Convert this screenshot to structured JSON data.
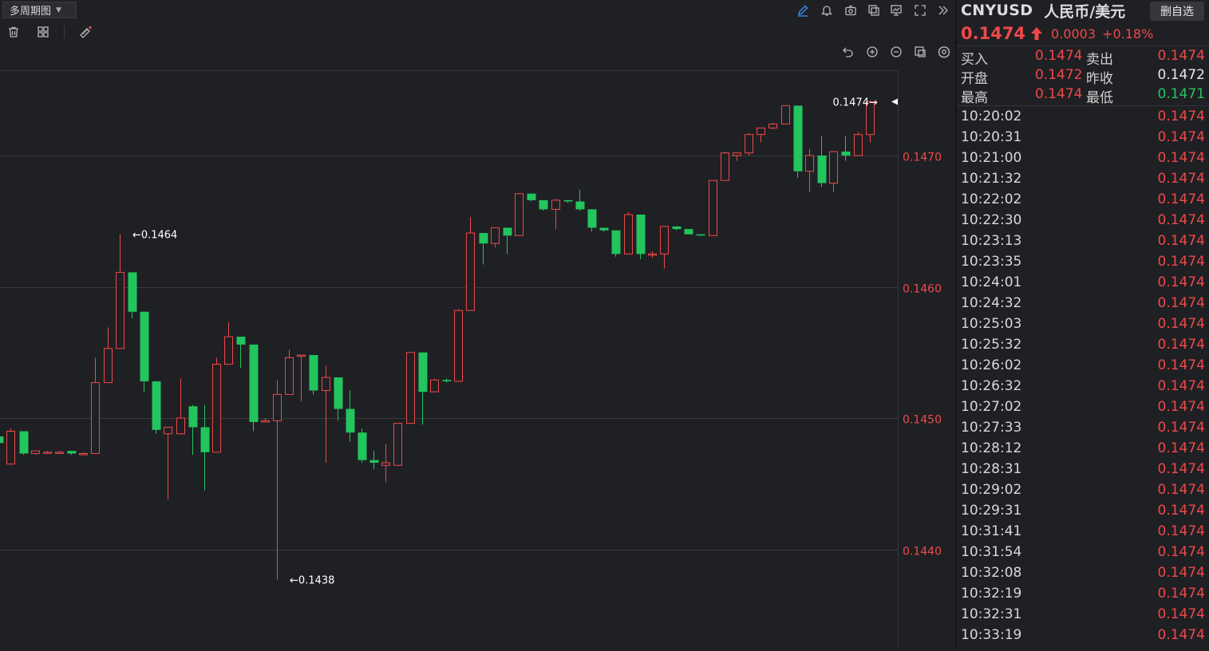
{
  "toolbar": {
    "period_label": "多周期图",
    "left_icons": [
      "trash-icon",
      "layout-icon",
      "ruler-icon"
    ],
    "right_icons": [
      "pencil-icon",
      "bell-icon",
      "camera-icon",
      "copy-icon",
      "indicator-icon",
      "fullscreen-icon",
      "collapse-icon"
    ],
    "chart_icons": [
      "undo-icon",
      "zoom-in-icon",
      "zoom-out-icon",
      "chart-style-icon",
      "settings-icon"
    ]
  },
  "colors": {
    "up": "#f04848",
    "down": "#22c55e",
    "background": "#1f2024"
  },
  "chart_data": {
    "type": "candlestick",
    "y_ticks": [
      "0.1470",
      "0.1460",
      "0.1450",
      "0.1440"
    ],
    "y_tick_values": [
      0.147,
      0.146,
      0.145,
      0.144
    ],
    "ylim": [
      0.14325,
      0.14765
    ],
    "annotations": [
      {
        "label": "←0.1464",
        "index": 11,
        "value": 0.1464,
        "side": "right"
      },
      {
        "label": "←0.1438",
        "index": 24,
        "value": 0.14377,
        "side": "right"
      },
      {
        "label": "0.1474→",
        "index": 73,
        "value": 0.14741,
        "side": "left"
      }
    ],
    "last_price_marker": 0.14741,
    "candles": [
      {
        "o": 0.14486,
        "h": 0.14492,
        "l": 0.14481,
        "c": 0.14481
      },
      {
        "o": 0.14465,
        "h": 0.14492,
        "l": 0.14465,
        "c": 0.1449
      },
      {
        "o": 0.1449,
        "h": 0.1449,
        "l": 0.14472,
        "c": 0.14473
      },
      {
        "o": 0.14473,
        "h": 0.14475,
        "l": 0.14472,
        "c": 0.14475
      },
      {
        "o": 0.14474,
        "h": 0.14475,
        "l": 0.14473,
        "c": 0.14474
      },
      {
        "o": 0.14474,
        "h": 0.14475,
        "l": 0.14473,
        "c": 0.14474
      },
      {
        "o": 0.14475,
        "h": 0.14475,
        "l": 0.14472,
        "c": 0.14473
      },
      {
        "o": 0.14473,
        "h": 0.14474,
        "l": 0.14473,
        "c": 0.14473
      },
      {
        "o": 0.14473,
        "h": 0.14546,
        "l": 0.14473,
        "c": 0.14527
      },
      {
        "o": 0.14527,
        "h": 0.14569,
        "l": 0.14527,
        "c": 0.14553
      },
      {
        "o": 0.14553,
        "h": 0.1464,
        "l": 0.14553,
        "c": 0.14611
      },
      {
        "o": 0.14611,
        "h": 0.14611,
        "l": 0.14576,
        "c": 0.14581
      },
      {
        "o": 0.14581,
        "h": 0.14581,
        "l": 0.1452,
        "c": 0.14528
      },
      {
        "o": 0.14528,
        "h": 0.14528,
        "l": 0.14488,
        "c": 0.14491
      },
      {
        "o": 0.14488,
        "h": 0.14493,
        "l": 0.14438,
        "c": 0.14493
      },
      {
        "o": 0.14488,
        "h": 0.1453,
        "l": 0.14488,
        "c": 0.145
      },
      {
        "o": 0.14509,
        "h": 0.1451,
        "l": 0.14472,
        "c": 0.14493
      },
      {
        "o": 0.14493,
        "h": 0.1451,
        "l": 0.14445,
        "c": 0.14474
      },
      {
        "o": 0.14474,
        "h": 0.14546,
        "l": 0.14474,
        "c": 0.14541
      },
      {
        "o": 0.14541,
        "h": 0.14573,
        "l": 0.14541,
        "c": 0.14562
      },
      {
        "o": 0.14562,
        "h": 0.14562,
        "l": 0.14538,
        "c": 0.14556
      },
      {
        "o": 0.14556,
        "h": 0.14556,
        "l": 0.1449,
        "c": 0.14497
      },
      {
        "o": 0.14497,
        "h": 0.145,
        "l": 0.14497,
        "c": 0.14498
      },
      {
        "o": 0.14498,
        "h": 0.14529,
        "l": 0.14377,
        "c": 0.14518
      },
      {
        "o": 0.14518,
        "h": 0.14552,
        "l": 0.14518,
        "c": 0.14546
      },
      {
        "o": 0.14548,
        "h": 0.14548,
        "l": 0.14513,
        "c": 0.14548
      },
      {
        "o": 0.14548,
        "h": 0.14548,
        "l": 0.14518,
        "c": 0.14521
      },
      {
        "o": 0.14521,
        "h": 0.1454,
        "l": 0.14466,
        "c": 0.14531
      },
      {
        "o": 0.14531,
        "h": 0.14531,
        "l": 0.14498,
        "c": 0.14507
      },
      {
        "o": 0.14507,
        "h": 0.14521,
        "l": 0.14482,
        "c": 0.14489
      },
      {
        "o": 0.14489,
        "h": 0.14492,
        "l": 0.14466,
        "c": 0.14468
      },
      {
        "o": 0.14468,
        "h": 0.14475,
        "l": 0.14461,
        "c": 0.14466
      },
      {
        "o": 0.14464,
        "h": 0.1448,
        "l": 0.14451,
        "c": 0.14466
      },
      {
        "o": 0.14464,
        "h": 0.14496,
        "l": 0.14464,
        "c": 0.14496
      },
      {
        "o": 0.14496,
        "h": 0.1455,
        "l": 0.14496,
        "c": 0.1455
      },
      {
        "o": 0.1455,
        "h": 0.1455,
        "l": 0.14495,
        "c": 0.1452
      },
      {
        "o": 0.1452,
        "h": 0.1453,
        "l": 0.1452,
        "c": 0.14529
      },
      {
        "o": 0.14529,
        "h": 0.1453,
        "l": 0.14527,
        "c": 0.14528
      },
      {
        "o": 0.14528,
        "h": 0.14583,
        "l": 0.14528,
        "c": 0.14582
      },
      {
        "o": 0.14582,
        "h": 0.14653,
        "l": 0.14582,
        "c": 0.14641
      },
      {
        "o": 0.14641,
        "h": 0.14641,
        "l": 0.14617,
        "c": 0.14633
      },
      {
        "o": 0.14633,
        "h": 0.14645,
        "l": 0.1463,
        "c": 0.14645
      },
      {
        "o": 0.14645,
        "h": 0.14645,
        "l": 0.14625,
        "c": 0.14639
      },
      {
        "o": 0.14639,
        "h": 0.14671,
        "l": 0.14639,
        "c": 0.14671
      },
      {
        "o": 0.14671,
        "h": 0.14671,
        "l": 0.14665,
        "c": 0.14666
      },
      {
        "o": 0.14666,
        "h": 0.14666,
        "l": 0.14658,
        "c": 0.14659
      },
      {
        "o": 0.14659,
        "h": 0.14667,
        "l": 0.14644,
        "c": 0.14666
      },
      {
        "o": 0.14666,
        "h": 0.14666,
        "l": 0.14664,
        "c": 0.14665
      },
      {
        "o": 0.14665,
        "h": 0.14674,
        "l": 0.14658,
        "c": 0.14659
      },
      {
        "o": 0.14659,
        "h": 0.14659,
        "l": 0.14642,
        "c": 0.14645
      },
      {
        "o": 0.14645,
        "h": 0.14645,
        "l": 0.14642,
        "c": 0.14643
      },
      {
        "o": 0.14643,
        "h": 0.14643,
        "l": 0.14623,
        "c": 0.14625
      },
      {
        "o": 0.14625,
        "h": 0.14657,
        "l": 0.14625,
        "c": 0.14655
      },
      {
        "o": 0.14655,
        "h": 0.14655,
        "l": 0.14621,
        "c": 0.14625
      },
      {
        "o": 0.14625,
        "h": 0.14627,
        "l": 0.14622,
        "c": 0.14625
      },
      {
        "o": 0.14625,
        "h": 0.14646,
        "l": 0.14614,
        "c": 0.14646
      },
      {
        "o": 0.14646,
        "h": 0.14646,
        "l": 0.14643,
        "c": 0.14644
      },
      {
        "o": 0.14644,
        "h": 0.14644,
        "l": 0.1464,
        "c": 0.1464
      },
      {
        "o": 0.1464,
        "h": 0.1464,
        "l": 0.14639,
        "c": 0.14639
      },
      {
        "o": 0.14639,
        "h": 0.14681,
        "l": 0.14639,
        "c": 0.14681
      },
      {
        "o": 0.14681,
        "h": 0.14703,
        "l": 0.14681,
        "c": 0.14702
      },
      {
        "o": 0.147,
        "h": 0.14702,
        "l": 0.14696,
        "c": 0.14702
      },
      {
        "o": 0.14702,
        "h": 0.14717,
        "l": 0.147,
        "c": 0.14716
      },
      {
        "o": 0.14716,
        "h": 0.14721,
        "l": 0.1471,
        "c": 0.14721
      },
      {
        "o": 0.14721,
        "h": 0.14725,
        "l": 0.1472,
        "c": 0.14724
      },
      {
        "o": 0.14724,
        "h": 0.14738,
        "l": 0.14724,
        "c": 0.14738
      },
      {
        "o": 0.14738,
        "h": 0.14738,
        "l": 0.14683,
        "c": 0.14688
      },
      {
        "o": 0.14688,
        "h": 0.14705,
        "l": 0.14672,
        "c": 0.147
      },
      {
        "o": 0.147,
        "h": 0.14715,
        "l": 0.14676,
        "c": 0.14679
      },
      {
        "o": 0.14679,
        "h": 0.14703,
        "l": 0.14672,
        "c": 0.14703
      },
      {
        "o": 0.14703,
        "h": 0.14715,
        "l": 0.14696,
        "c": 0.147
      },
      {
        "o": 0.147,
        "h": 0.14718,
        "l": 0.147,
        "c": 0.14716
      },
      {
        "o": 0.14716,
        "h": 0.14742,
        "l": 0.1471,
        "c": 0.14741
      }
    ]
  },
  "panel": {
    "code": "CNYUSD",
    "name": "人民币/美元",
    "delete_btn": "删自选",
    "price": "0.1474",
    "change": "0.0003",
    "change_pct": "+0.18%",
    "quote": [
      {
        "l1": "买入",
        "v1": "0.1474",
        "l2": "卖出",
        "v2": "0.1474",
        "v2_color": "#f04848"
      },
      {
        "l1": "开盘",
        "v1": "0.1472",
        "l2": "昨收",
        "v2": "0.1472",
        "v2_color": "#e8e8e8"
      },
      {
        "l1": "最高",
        "v1": "0.1474",
        "l2": "最低",
        "v2": "0.1471",
        "v2_color": "#22c55e"
      }
    ],
    "ticks": [
      {
        "time": "10:20:02",
        "price": "0.1474"
      },
      {
        "time": "10:20:31",
        "price": "0.1474"
      },
      {
        "time": "10:21:00",
        "price": "0.1474"
      },
      {
        "time": "10:21:32",
        "price": "0.1474"
      },
      {
        "time": "10:22:02",
        "price": "0.1474"
      },
      {
        "time": "10:22:30",
        "price": "0.1474"
      },
      {
        "time": "10:23:13",
        "price": "0.1474"
      },
      {
        "time": "10:23:35",
        "price": "0.1474"
      },
      {
        "time": "10:24:01",
        "price": "0.1474"
      },
      {
        "time": "10:24:32",
        "price": "0.1474"
      },
      {
        "time": "10:25:03",
        "price": "0.1474"
      },
      {
        "time": "10:25:32",
        "price": "0.1474"
      },
      {
        "time": "10:26:02",
        "price": "0.1474"
      },
      {
        "time": "10:26:32",
        "price": "0.1474"
      },
      {
        "time": "10:27:02",
        "price": "0.1474"
      },
      {
        "time": "10:27:33",
        "price": "0.1474"
      },
      {
        "time": "10:28:12",
        "price": "0.1474"
      },
      {
        "time": "10:28:31",
        "price": "0.1474"
      },
      {
        "time": "10:29:02",
        "price": "0.1474"
      },
      {
        "time": "10:29:31",
        "price": "0.1474"
      },
      {
        "time": "10:31:41",
        "price": "0.1474"
      },
      {
        "time": "10:31:54",
        "price": "0.1474"
      },
      {
        "time": "10:32:08",
        "price": "0.1474"
      },
      {
        "time": "10:32:19",
        "price": "0.1474"
      },
      {
        "time": "10:32:31",
        "price": "0.1474"
      },
      {
        "time": "10:33:19",
        "price": "0.1474"
      }
    ]
  }
}
